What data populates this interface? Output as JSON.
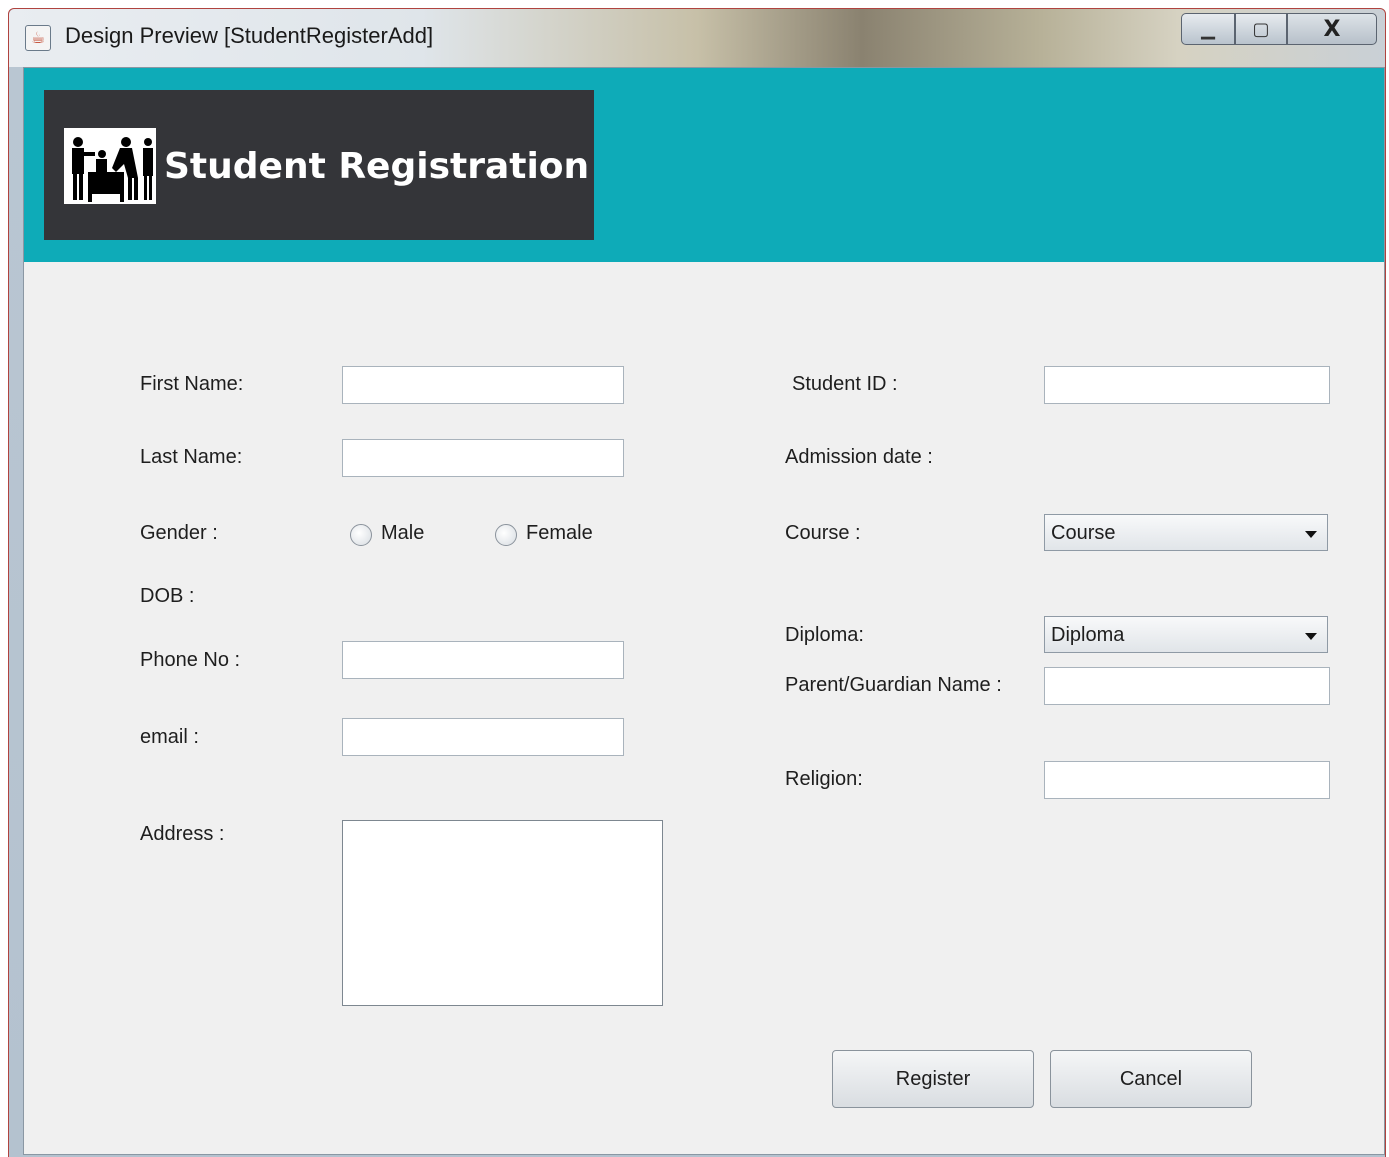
{
  "window": {
    "title": "Design Preview [StudentRegisterAdd]",
    "minimize_glyph": "▁",
    "maximize_glyph": "▢",
    "close_glyph": "X"
  },
  "header": {
    "title": "Student Registration",
    "logo_icon": "students-teacher-icon",
    "band_color": "#0eabb8",
    "box_color": "#343539"
  },
  "form": {
    "first_name": {
      "label": "First Name:",
      "value": ""
    },
    "last_name": {
      "label": "Last Name:",
      "value": ""
    },
    "gender": {
      "label": "Gender :",
      "options": [
        "Male",
        "Female"
      ],
      "selected": null
    },
    "dob": {
      "label": "DOB :"
    },
    "phone": {
      "label": "Phone No :",
      "value": ""
    },
    "email": {
      "label": "email :",
      "value": ""
    },
    "address": {
      "label": "Address :",
      "value": ""
    },
    "student_id": {
      "label": "Student ID :",
      "value": ""
    },
    "admission_date": {
      "label": "Admission date :"
    },
    "course": {
      "label": "Course :",
      "selected": "Course"
    },
    "diploma": {
      "label": "Diploma:",
      "selected": "Diploma"
    },
    "parent_name": {
      "label": "Parent/Guardian Name :",
      "value": ""
    },
    "religion": {
      "label": "Religion:",
      "value": ""
    }
  },
  "actions": {
    "register_label": "Register",
    "cancel_label": "Cancel"
  }
}
